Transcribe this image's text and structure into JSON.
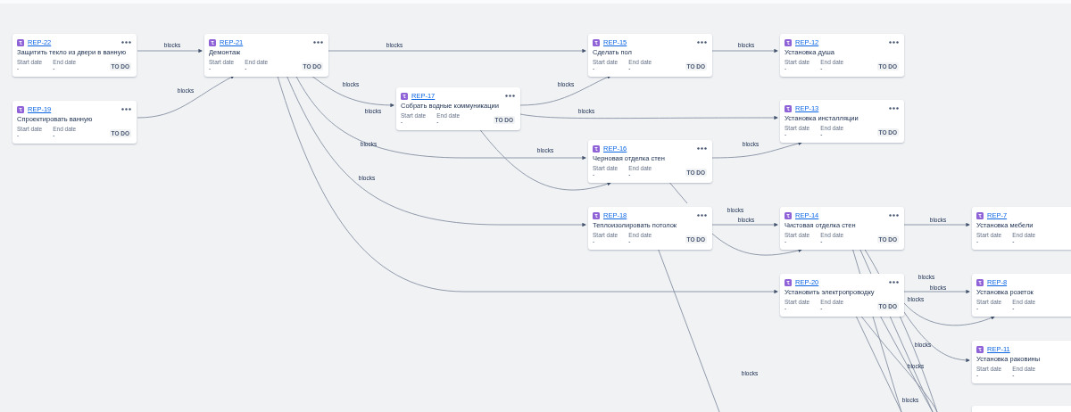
{
  "issues": [
    {
      "key": "REP-22",
      "title": "Защитить текло из двери в ванную",
      "fields": [
        {
          "label": "Start date",
          "value": "-"
        },
        {
          "label": "End date",
          "value": "-"
        }
      ],
      "status": "TO DO"
    },
    {
      "key": "REP-19",
      "title": "Спроектировать ванную",
      "fields": [
        {
          "label": "Start date",
          "value": "-"
        },
        {
          "label": "End date",
          "value": "-"
        }
      ],
      "status": "TO DO"
    },
    {
      "key": "REP-21",
      "title": "Демонтаж",
      "fields": [
        {
          "label": "Start date",
          "value": "-"
        },
        {
          "label": "End date",
          "value": "-"
        }
      ],
      "status": "TO DO"
    },
    {
      "key": "REP-17",
      "title": "Собрать водные коммуникации",
      "fields": [
        {
          "label": "Start date",
          "value": "-"
        },
        {
          "label": "End date",
          "value": "-"
        }
      ],
      "status": "TO DO"
    },
    {
      "key": "REP-15",
      "title": "Сделать пол",
      "fields": [
        {
          "label": "Start date",
          "value": "-"
        },
        {
          "label": "End date",
          "value": "-"
        }
      ],
      "status": "TO DO"
    },
    {
      "key": "REP-16",
      "title": "Черновая отделка стен",
      "fields": [
        {
          "label": "Start date",
          "value": "-"
        },
        {
          "label": "End date",
          "value": "-"
        }
      ],
      "status": "TO DO"
    },
    {
      "key": "REP-18",
      "title": "Теплоизолировать потолок",
      "fields": [
        {
          "label": "Start date",
          "value": "-"
        },
        {
          "label": "End date",
          "value": "-"
        }
      ],
      "status": "TO DO"
    },
    {
      "key": "REP-12",
      "title": "Установка душа",
      "fields": [
        {
          "label": "Start date",
          "value": "-"
        },
        {
          "label": "End date",
          "value": "-"
        }
      ],
      "status": "TO DO"
    },
    {
      "key": "REP-13",
      "title": "Установка инсталляции",
      "fields": [
        {
          "label": "Start date",
          "value": "-"
        },
        {
          "label": "End date",
          "value": "-"
        }
      ],
      "status": "TO DO"
    },
    {
      "key": "REP-14",
      "title": "Чистовая отделка стен",
      "fields": [
        {
          "label": "Start date",
          "value": "-"
        },
        {
          "label": "End date",
          "value": "-"
        }
      ],
      "status": "TO DO"
    },
    {
      "key": "REP-20",
      "title": "Установить электропроводку",
      "fields": [
        {
          "label": "Start date",
          "value": "-"
        },
        {
          "label": "End date",
          "value": "-"
        }
      ],
      "status": "TO DO"
    },
    {
      "key": "REP-7",
      "title": "Установка мебели",
      "fields": [
        {
          "label": "Start date",
          "value": "-"
        },
        {
          "label": "End date",
          "value": "-"
        }
      ]
    },
    {
      "key": "REP-8",
      "title": "Установка розеток",
      "fields": [
        {
          "label": "Start date",
          "value": "-"
        },
        {
          "label": "End date",
          "value": "-"
        }
      ]
    },
    {
      "key": "REP-11",
      "title": "Установка раковины",
      "fields": [
        {
          "label": "Start date",
          "value": "-"
        },
        {
          "label": "End date",
          "value": "-"
        }
      ]
    }
  ],
  "edge_labels": [
    "blocks",
    "blocks",
    "blocks",
    "blocks",
    "blocks",
    "blocks",
    "blocks",
    "blocks",
    "blocks",
    "blocks",
    "blocks",
    "blocks",
    "blocks",
    "blocks",
    "blocks",
    "blocks",
    "blocks",
    "blocks",
    "blocks",
    "blocks",
    "blocks",
    "blocks"
  ]
}
